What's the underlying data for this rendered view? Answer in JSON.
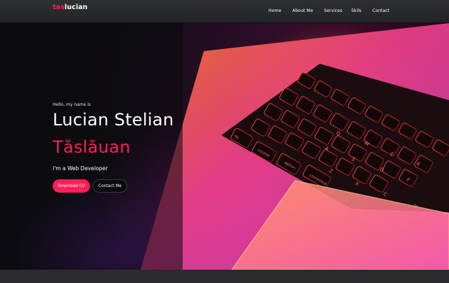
{
  "navbar": {
    "logo_accent": "tas",
    "logo_main": "lucian",
    "links": [
      "Home",
      "About Me",
      "Services",
      "Skils",
      "Contact"
    ]
  },
  "hero": {
    "greeting": "Hello, my name is",
    "first_name": "Lucian Stelian",
    "last_name": "Tăslăuan",
    "role": "I'm a Web Developer",
    "download_cv": "Download CV",
    "contact_me": "Contact Me"
  },
  "keyboard": {
    "keys": [
      "fn",
      "control",
      "option",
      "command",
      "Q",
      "W",
      "E",
      "R",
      "A",
      "S",
      "D",
      "F",
      "Z",
      "X",
      "C",
      "V"
    ]
  },
  "colors": {
    "accent": "#ff1e56",
    "navbar": "#2a2c2f",
    "background": "#0b0b0d"
  }
}
